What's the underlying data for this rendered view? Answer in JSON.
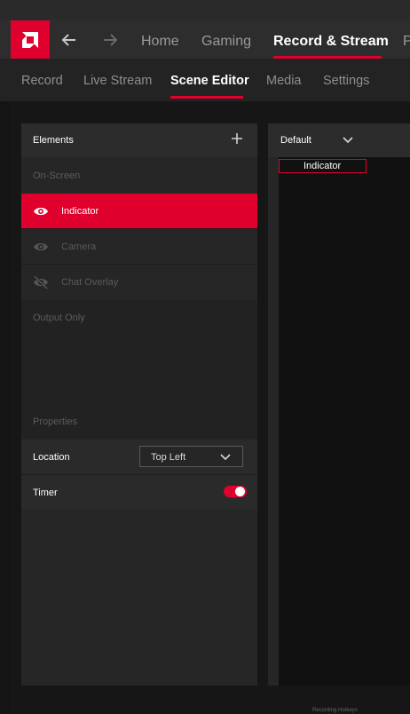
{
  "nav": {
    "home": "Home",
    "gaming": "Gaming",
    "record_stream": "Record & Stream",
    "overflow": "P"
  },
  "subnav": {
    "record": "Record",
    "live_stream": "Live Stream",
    "scene_editor": "Scene Editor",
    "media": "Media",
    "settings": "Settings"
  },
  "elements_panel": {
    "title": "Elements",
    "on_screen_label": "On-Screen",
    "items": [
      {
        "label": "Indicator",
        "icon": "eye-icon",
        "selected": true
      },
      {
        "label": "Camera",
        "icon": "eye-icon",
        "selected": false
      },
      {
        "label": "Chat Overlay",
        "icon": "eye-off-icon",
        "selected": false
      }
    ],
    "output_only_label": "Output Only"
  },
  "properties": {
    "title": "Properties",
    "location_label": "Location",
    "location_value": "Top Left",
    "timer_label": "Timer",
    "timer_enabled": true
  },
  "canvas": {
    "scene_name": "Default",
    "indicator_label": "Indicator"
  },
  "footer": {
    "hint": "Recording Hotkeys"
  },
  "colors": {
    "accent": "#e0002e",
    "background": "#141414",
    "panel": "#262626"
  }
}
